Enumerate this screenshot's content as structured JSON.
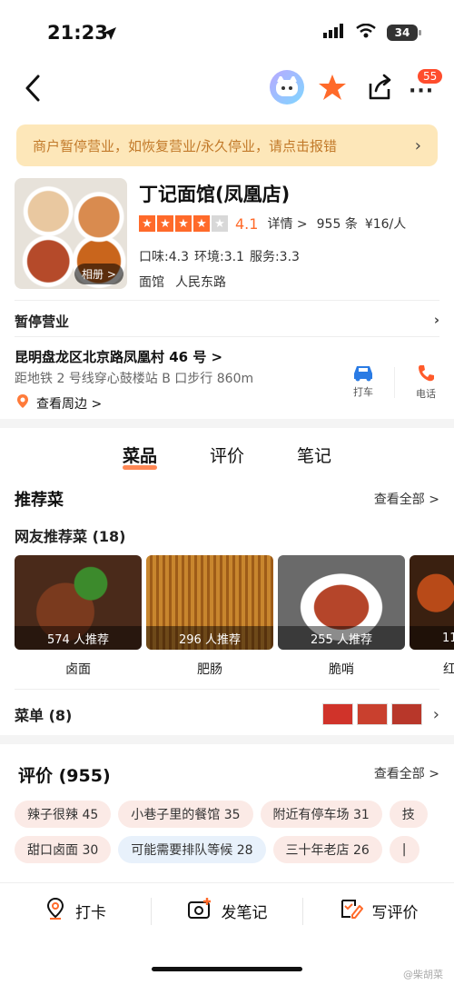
{
  "status": {
    "time": "21:23",
    "battery": "34"
  },
  "nav": {
    "badge": "55"
  },
  "notice": {
    "text": "商户暂停营业，如恢复营业/永久停业，请点击报错"
  },
  "shop": {
    "name": "丁记面馆(凤凰店)",
    "album": "相册 >",
    "stars_value": 4.1,
    "score": "4.1",
    "detail": "详情 >",
    "review_count": "955 条",
    "price": "¥16/人",
    "subscores": [
      "口味:4.3",
      "环境:3.1",
      "服务:3.3"
    ],
    "category": "面馆",
    "area": "人民东路"
  },
  "status_row": {
    "text": "暂停营业"
  },
  "address": {
    "line": "昆明盘龙区北京路凤凰村 46 号 >",
    "metro": "距地铁 2 号线穿心鼓楼站 B 口步行 860m",
    "nearby": "查看周边 >",
    "taxi": "打车",
    "phone": "电话"
  },
  "tabs": [
    "菜品",
    "评价",
    "笔记"
  ],
  "recommend": {
    "title": "推荐菜",
    "see_all": "查看全部 >",
    "subtitle": "网友推荐菜 (18)",
    "dishes": [
      {
        "name": "卤面",
        "count": "574 人推荐"
      },
      {
        "name": "肥肠",
        "count": "296 人推荐"
      },
      {
        "name": "脆哨",
        "count": "255 人推荐"
      },
      {
        "name": "红",
        "count": "11"
      }
    ]
  },
  "menu": {
    "label": "菜单 (8)"
  },
  "reviews": {
    "title": "评价 (955)",
    "see_all": "查看全部 >",
    "tags_row1": [
      "辣子很辣 45",
      "小巷子里的餐馆 35",
      "附近有停车场 31",
      "技"
    ],
    "tags_row2": [
      "甜口卤面 30",
      "可能需要排队等候 28",
      "三十年老店 26",
      "|"
    ]
  },
  "bottom": {
    "checkin": "打卡",
    "note": "发笔记",
    "review": "写评价"
  },
  "watermark": "@柴胡菜",
  "colors": {
    "accent": "#ff6a2a",
    "notice_bg": "#fde7b9",
    "notice_text": "#c27a2a"
  }
}
